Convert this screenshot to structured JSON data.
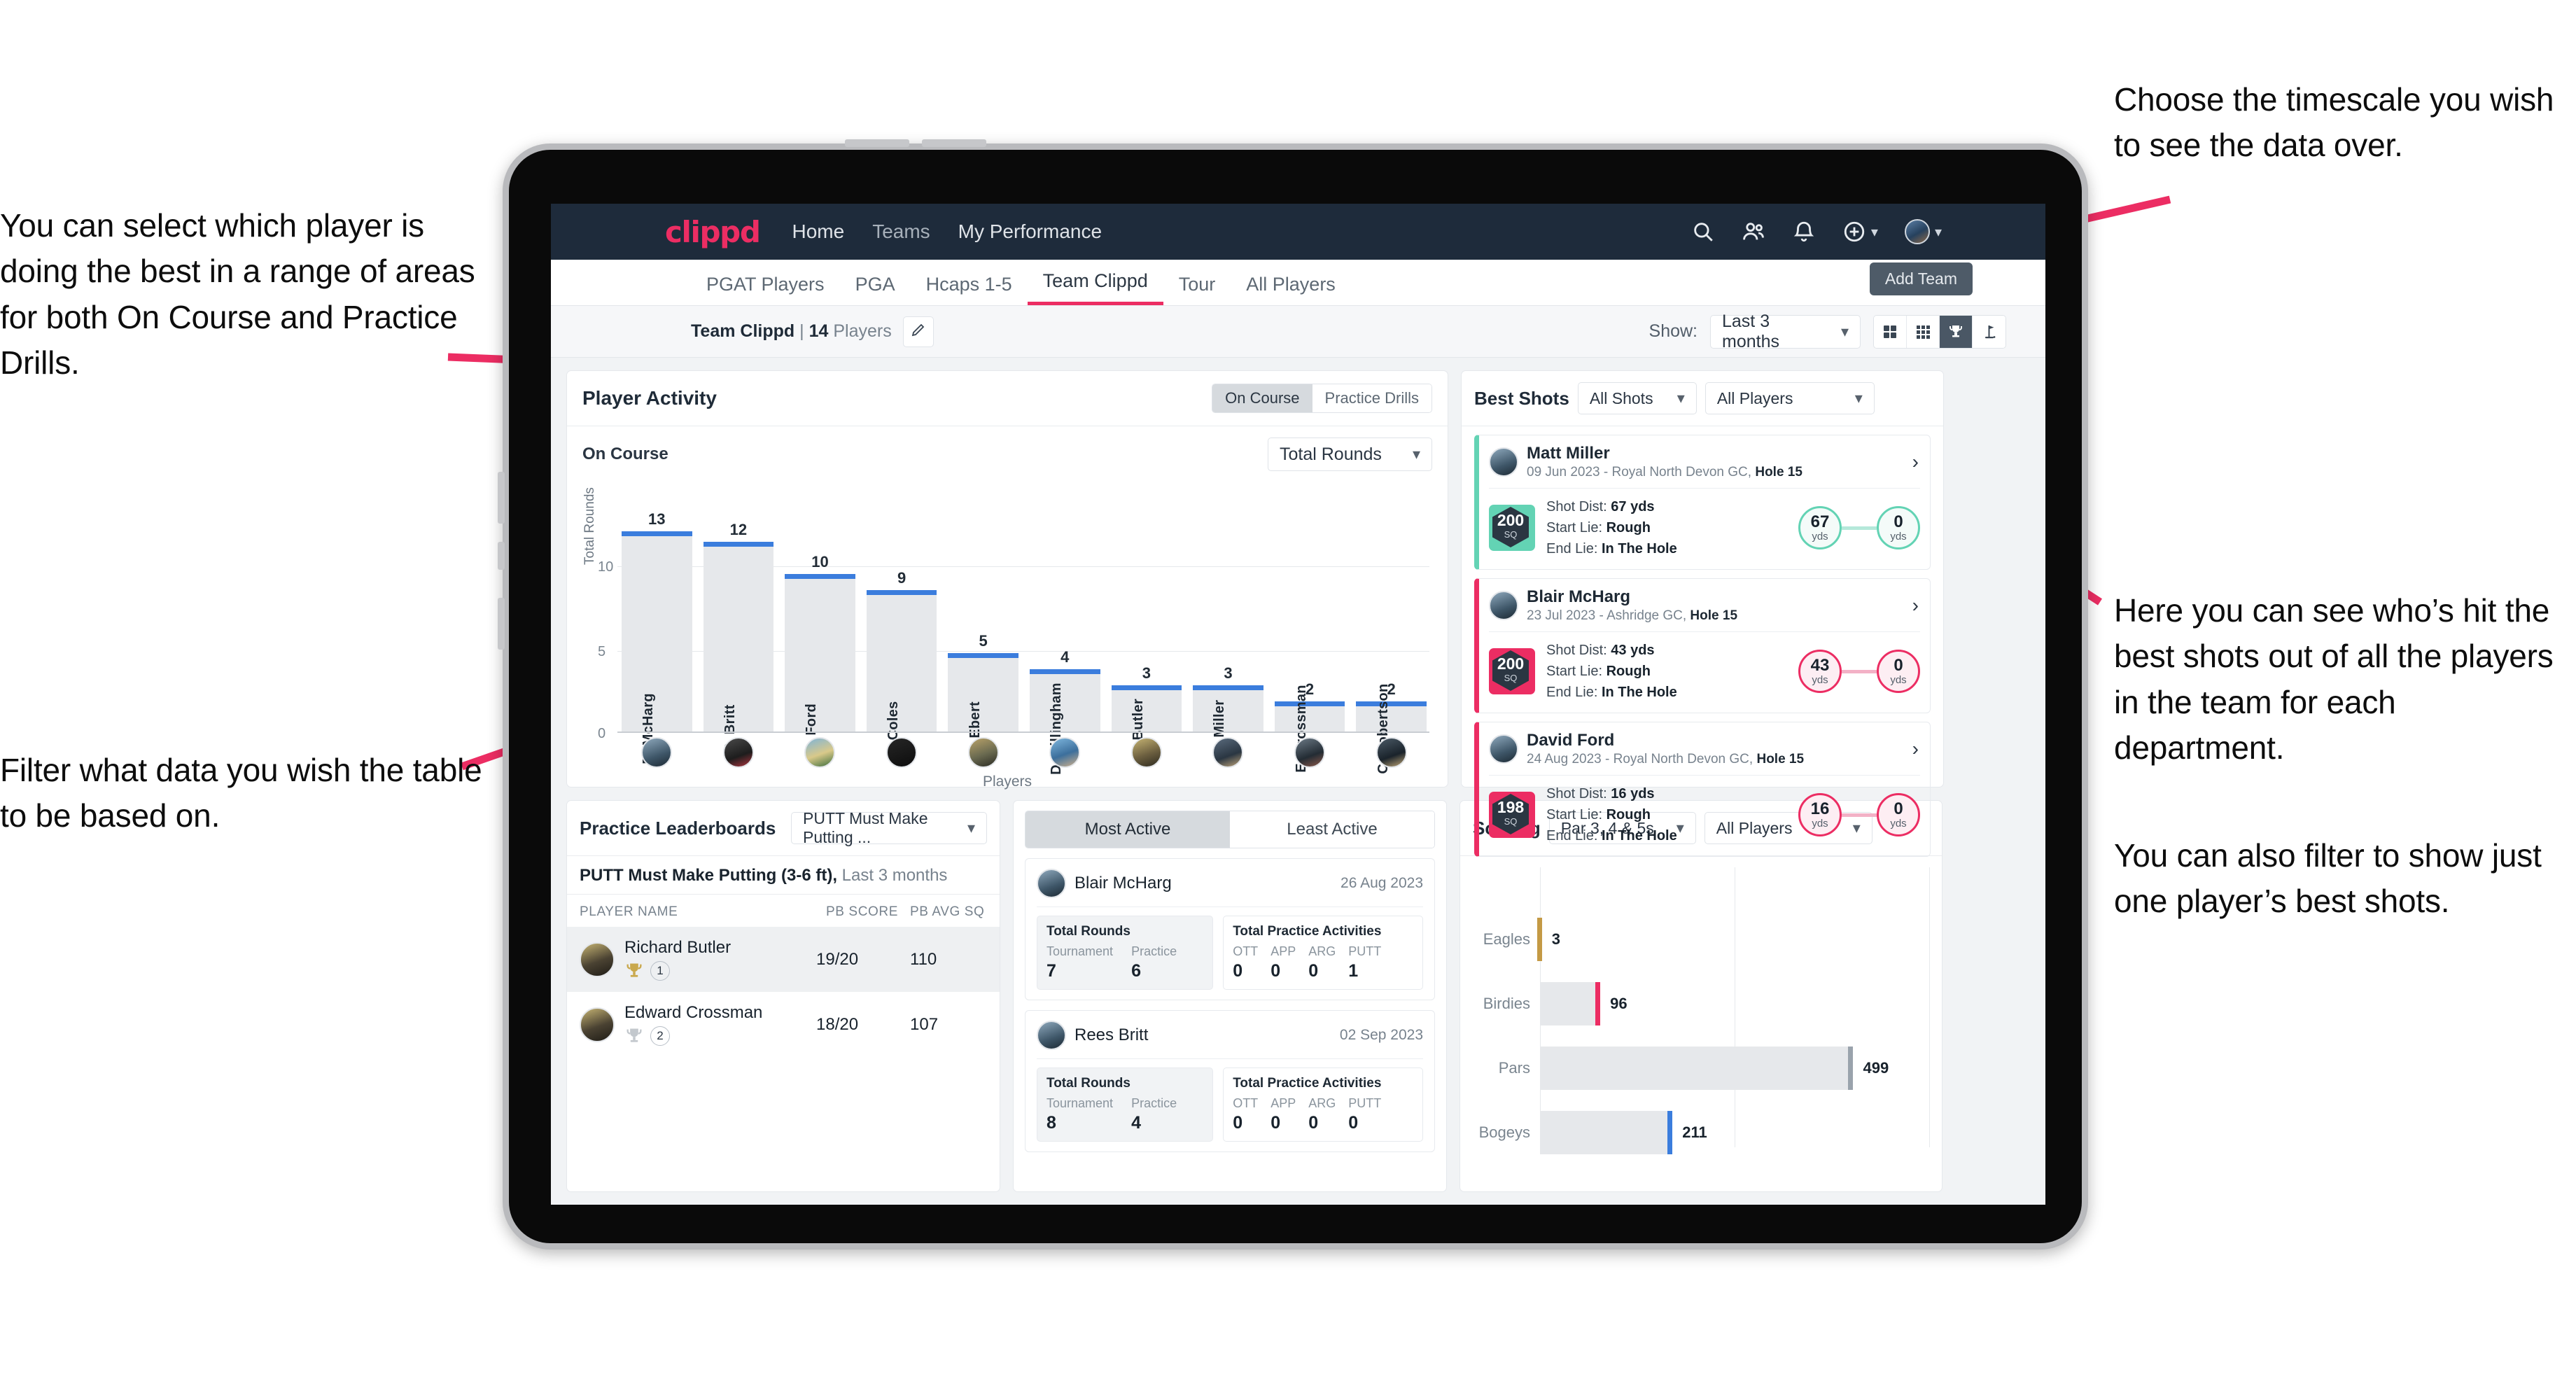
{
  "annotations": {
    "select_player": "You can select which player is doing the best in a range of areas for both On Course and Practice Drills.",
    "filter_table": "Filter what data you wish the table to be based on.",
    "timescale": "Choose the timescale you wish to see the data over.",
    "best_shots": "Here you can see who’s hit the best shots out of all the players in the team for each department.",
    "filter_one_player": "You can also filter to show just one player’s best shots."
  },
  "topnav": {
    "logo": "clippd",
    "links": [
      "Home",
      "Teams",
      "My Performance"
    ],
    "icons": [
      "search-icon",
      "people-icon",
      "bell-icon",
      "plus-circle-icon",
      "avatar"
    ]
  },
  "tabs": {
    "items": [
      "PGAT Players",
      "PGA",
      "Hcaps 1-5",
      "Team Clippd",
      "Tour",
      "All Players"
    ],
    "active": "Team Clippd",
    "tooltip": "Add Team"
  },
  "subbar": {
    "team_name": "Team Clippd",
    "separator": "|",
    "player_count": "14",
    "players_word": "Players",
    "edit_icon": "pencil-icon",
    "show_label": "Show:",
    "period_value": "Last 3 months",
    "view_icons": [
      "grid-large-icon",
      "grid-small-icon",
      "trophy-icon",
      "flag-icon"
    ],
    "view_active": "trophy-icon"
  },
  "player_activity": {
    "title": "Player Activity",
    "segments": [
      "On Course",
      "Practice Drills"
    ],
    "segment_active": "On Course",
    "sub_title": "On Course",
    "metric_value": "Total Rounds"
  },
  "chart_data": {
    "type": "bar",
    "title": "Player Activity – On Course",
    "categories": [
      "B. McHarg",
      "R. Britt",
      "D. Ford",
      "J. Coles",
      "E. Ebert",
      "D. Billingham",
      "R. Butler",
      "M. Miller",
      "E. Crossman",
      "C. Robertson"
    ],
    "values": [
      13,
      12,
      10,
      9,
      5,
      4,
      3,
      3,
      2,
      2
    ],
    "xlabel": "Players",
    "ylabel": "Total Rounds",
    "yticks": [
      "0",
      "5",
      "10"
    ],
    "ylim": [
      0,
      14
    ],
    "grid": true,
    "bar_color": "#e6e8eb",
    "bar_cap_color": "#3b7ddd"
  },
  "best_shots": {
    "title": "Best Shots",
    "filter_shots": "All Shots",
    "filter_players": "All Players",
    "shots": [
      {
        "player": "Matt Miller",
        "meta_date": "09 Jun 2023",
        "meta_course": "Royal North Devon GC,",
        "meta_hole": "Hole 15",
        "sq": "200",
        "sq_unit": "SQ",
        "shot_dist_label": "Shot Dist:",
        "shot_dist": "67 yds",
        "start_lie_label": "Start Lie:",
        "start_lie": "Rough",
        "end_lie_label": "End Lie:",
        "end_lie": "In The Hole",
        "from_value": "67",
        "from_unit": "yds",
        "to_value": "0",
        "to_unit": "yds",
        "accent": "#63d3b4"
      },
      {
        "player": "Blair McHarg",
        "meta_date": "23 Jul 2023",
        "meta_course": "Ashridge GC,",
        "meta_hole": "Hole 15",
        "sq": "200",
        "sq_unit": "SQ",
        "shot_dist_label": "Shot Dist:",
        "shot_dist": "43 yds",
        "start_lie_label": "Start Lie:",
        "start_lie": "Rough",
        "end_lie_label": "End Lie:",
        "end_lie": "In The Hole",
        "from_value": "43",
        "from_unit": "yds",
        "to_value": "0",
        "to_unit": "yds",
        "accent": "#ec2d63"
      },
      {
        "player": "David Ford",
        "meta_date": "24 Aug 2023",
        "meta_course": "Royal North Devon GC,",
        "meta_hole": "Hole 15",
        "sq": "198",
        "sq_unit": "SQ",
        "shot_dist_label": "Shot Dist:",
        "shot_dist": "16 yds",
        "start_lie_label": "Start Lie:",
        "start_lie": "Rough",
        "end_lie_label": "End Lie:",
        "end_lie": "In The Hole",
        "from_value": "16",
        "from_unit": "yds",
        "to_value": "0",
        "to_unit": "yds",
        "accent": "#ec2d63"
      }
    ]
  },
  "practice_leaderboards": {
    "title": "Practice Leaderboards",
    "drill_select": "PUTT Must Make Putting ...",
    "sub_title": "PUTT Must Make Putting (3-6 ft),",
    "sub_period": "Last 3 months",
    "columns": [
      "PLAYER NAME",
      "PB SCORE",
      "PB AVG SQ"
    ],
    "rows": [
      {
        "name": "Richard Butler",
        "rank": "1",
        "trophy": "gold",
        "pb_score": "19/20",
        "pb_avg_sq": "110"
      },
      {
        "name": "Edward Crossman",
        "rank": "2",
        "trophy": "silver",
        "pb_score": "18/20",
        "pb_avg_sq": "107"
      }
    ]
  },
  "activity": {
    "tabs": [
      "Most Active",
      "Least Active"
    ],
    "active_tab": "Most Active",
    "rounds_title": "Total Rounds",
    "rounds_cols": [
      "Tournament",
      "Practice"
    ],
    "practice_title": "Total Practice Activities",
    "practice_cols": [
      "OTT",
      "APP",
      "ARG",
      "PUTT"
    ],
    "cards": [
      {
        "name": "Blair McHarg",
        "date": "26 Aug 2023",
        "tournament": "7",
        "practice": "6",
        "ott": "0",
        "app": "0",
        "arg": "0",
        "putt": "1"
      },
      {
        "name": "Rees Britt",
        "date": "02 Sep 2023",
        "tournament": "8",
        "practice": "4",
        "ott": "0",
        "app": "0",
        "arg": "0",
        "putt": "0"
      }
    ]
  },
  "scoring": {
    "title": "Scoring",
    "filter_par": "Par 3, 4 & 5s",
    "filter_players": "All Players"
  },
  "scoring_chart": {
    "type": "bar",
    "orientation": "horizontal",
    "title": "Scoring",
    "categories": [
      "Eagles",
      "Birdies",
      "Pars",
      "Bogeys"
    ],
    "values": [
      3,
      96,
      499,
      211
    ],
    "colors": [
      "#c49a45",
      "#ec2d63",
      "#9aa3ac",
      "#3b7ddd"
    ],
    "xlim": [
      0,
      620
    ],
    "grid": true
  },
  "colors": {
    "brand_pink": "#ec2d63",
    "navy": "#1e2b3b",
    "teal": "#63d3b4",
    "bar_blue": "#3b7ddd",
    "page_bg": "#f1f3f5"
  }
}
